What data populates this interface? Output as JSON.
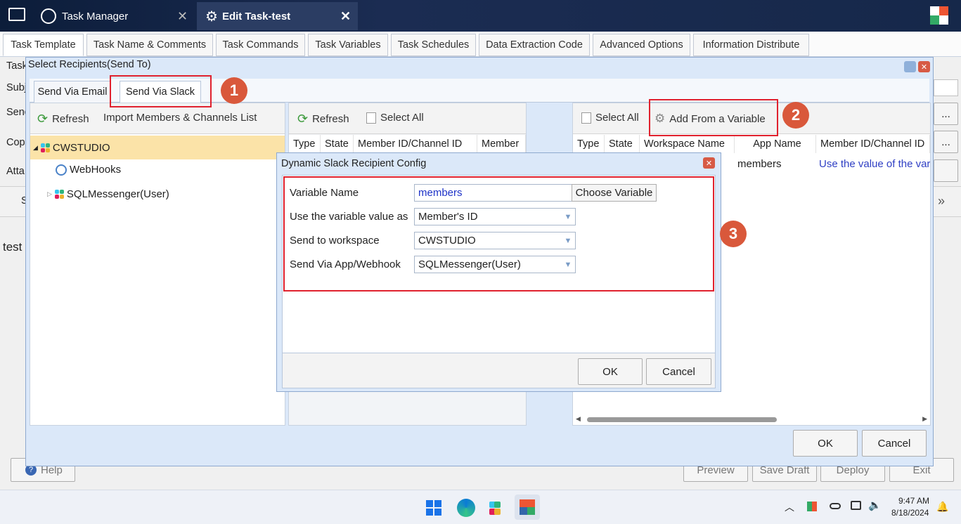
{
  "titlebar": {
    "tab1": "Task Manager",
    "tab2": "Edit Task-test"
  },
  "tabs": [
    "Task Template",
    "Task Name & Comments",
    "Task Commands",
    "Task Variables",
    "Task Schedules",
    "Data Extraction Code",
    "Advanced Options",
    "Information Distribute"
  ],
  "behind": {
    "task": "Task",
    "subj": "Subj",
    "send": "Send",
    "cop": "Cop",
    "atta": "Atta",
    "test": "test",
    "s": "S",
    "ellipsis": "...",
    "chev": "»"
  },
  "bottom_buttons": {
    "help": "Help",
    "preview": "Preview",
    "save_draft": "Save Draft",
    "deploy": "Deploy",
    "exit": "Exit"
  },
  "window": {
    "title": "Select Recipients(Send To)",
    "tab_email": "Send Via Email",
    "tab_slack": "Send Via Slack",
    "ok": "OK",
    "cancel": "Cancel"
  },
  "left_panel": {
    "refresh": "Refresh",
    "import": "Import Members & Channels List",
    "tree": {
      "root": "CWSTUDIO",
      "child1": "WebHooks",
      "child2": "SQLMessenger(User)"
    }
  },
  "middle_panel": {
    "refresh": "Refresh",
    "select_all": "Select All",
    "columns": [
      "Type",
      "State",
      "Member ID/Channel ID",
      "Member"
    ]
  },
  "right_panel": {
    "select_all": "Select All",
    "add_var": "Add From a Variable",
    "columns": [
      "Type",
      "State",
      "Workspace Name",
      "App Name",
      "Member ID/Channel ID"
    ],
    "row": {
      "app": "members",
      "member": "Use the value of the variable"
    }
  },
  "badges": [
    "1",
    "2",
    "3"
  ],
  "dialog": {
    "title": "Dynamic Slack Recipient Config",
    "var_name_label": "Variable Name",
    "var_name_value": "members",
    "choose": "Choose Variable",
    "use_as_label": "Use the variable value as",
    "use_as_value": "Member's ID",
    "workspace_label": "Send to workspace",
    "workspace_value": "CWSTUDIO",
    "app_label": "Send Via App/Webhook",
    "app_value": "SQLMessenger(User)",
    "ok": "OK",
    "cancel": "Cancel"
  },
  "clock": {
    "time": "9:47 AM",
    "date": "8/18/2024"
  },
  "colors": {
    "accent": "#2f64c4",
    "red": "#e0212e",
    "badge": "#d9583b",
    "tree_sel": "#fbe3a8"
  }
}
